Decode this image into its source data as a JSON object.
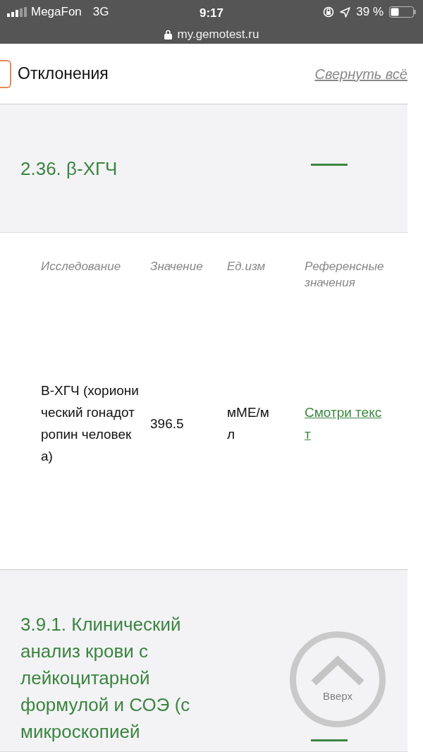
{
  "status_bar": {
    "carrier": "MegaFon",
    "network": "3G",
    "time": "9:17",
    "battery": "39 %",
    "url": "my.gemotest.ru"
  },
  "filter": {
    "label": "Отклонения",
    "checked": false,
    "collapse_link": "Свернуть всё"
  },
  "sections": [
    {
      "title": "2.36. β-ХГЧ",
      "expanded": true,
      "table": {
        "columns": [
          "Исследование",
          "Значение",
          "Ед.изм",
          "Референсные значения"
        ],
        "rows": [
          {
            "test": "В-ХГЧ (хорионический гонадотропин человека)",
            "value": "396.5",
            "unit": "мМЕ/мл",
            "reference": "Смотри текст"
          }
        ]
      }
    },
    {
      "title": "3.9.1. Клинический анализ крови с лейкоцитарной формулой и СОЭ (с микроскопией",
      "expanded": true
    }
  ],
  "scroll_top_button": {
    "label": "Вверх"
  }
}
